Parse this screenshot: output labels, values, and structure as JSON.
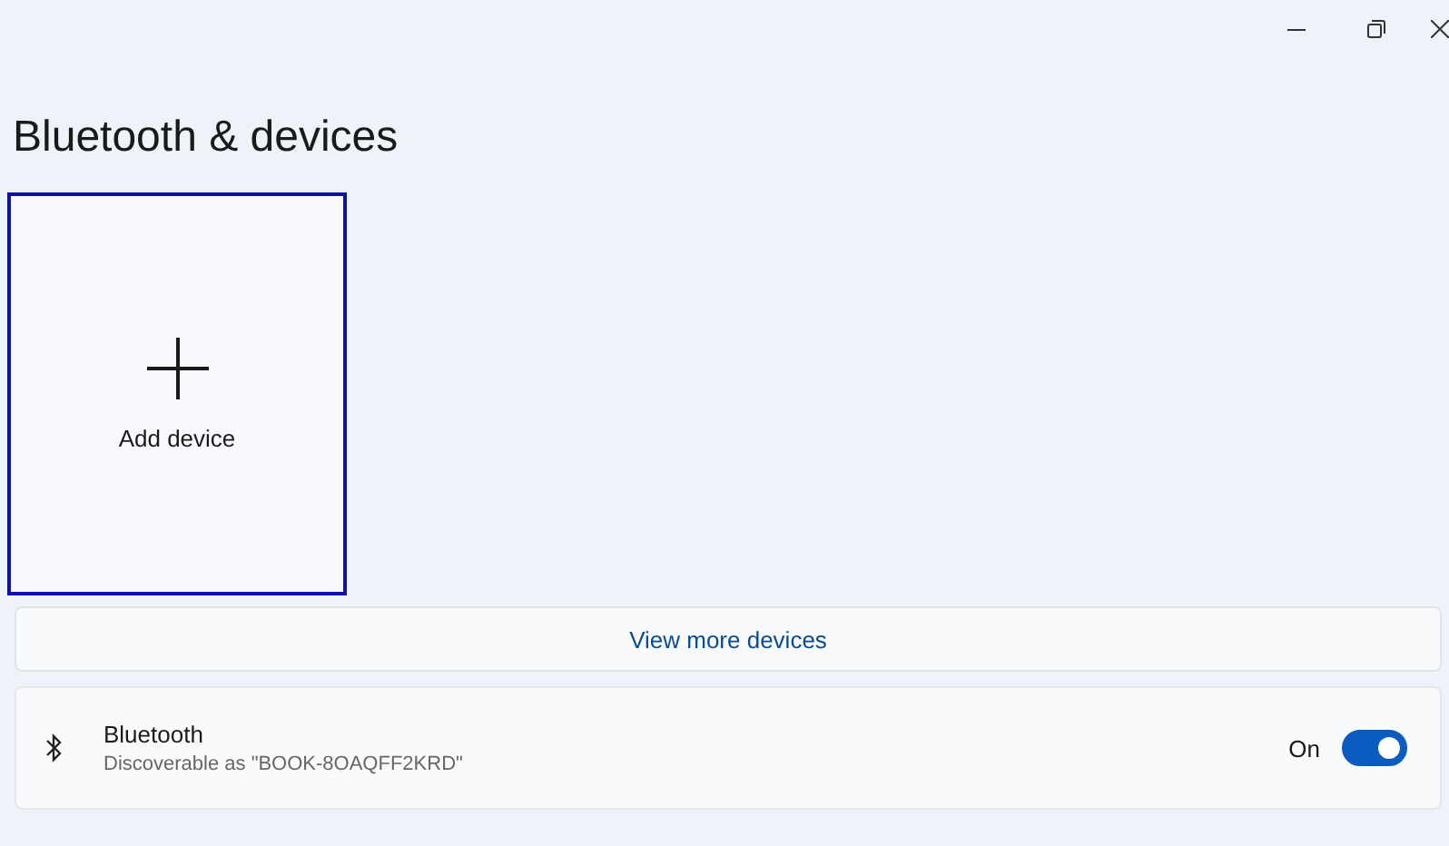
{
  "page": {
    "title": "Bluetooth & devices"
  },
  "add_device_card": {
    "label": "Add device",
    "focused": true
  },
  "view_more": {
    "label": "View more devices"
  },
  "bluetooth": {
    "title": "Bluetooth",
    "subtitle": "Discoverable as \"BOOK-8OAQFF2KRD\"",
    "state_label": "On",
    "on": true
  }
}
